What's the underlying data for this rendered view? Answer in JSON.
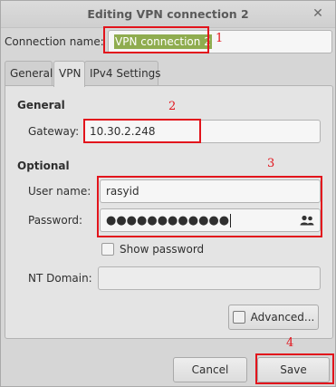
{
  "window": {
    "title": "Editing VPN connection 2"
  },
  "connection_name": {
    "label": "Connection name:",
    "value": "VPN connection 2"
  },
  "tabs": [
    {
      "label": "General"
    },
    {
      "label": "VPN"
    },
    {
      "label": "IPv4 Settings"
    }
  ],
  "general": {
    "section_title": "General",
    "gateway_label": "Gateway:",
    "gateway_value": "10.30.2.248"
  },
  "optional": {
    "section_title": "Optional",
    "username_label": "User name:",
    "username_value": "rasyid",
    "password_label": "Password:",
    "password_value": "●●●●●●●●●●●●",
    "show_password_label": "Show password",
    "nt_domain_label": "NT Domain:",
    "nt_domain_value": ""
  },
  "buttons": {
    "advanced": "Advanced...",
    "cancel": "Cancel",
    "save": "Save"
  },
  "annotations": [
    "1",
    "2",
    "3",
    "4"
  ],
  "colors": {
    "annotation_red": "#e2141c",
    "selection_green": "#8fac4f"
  }
}
